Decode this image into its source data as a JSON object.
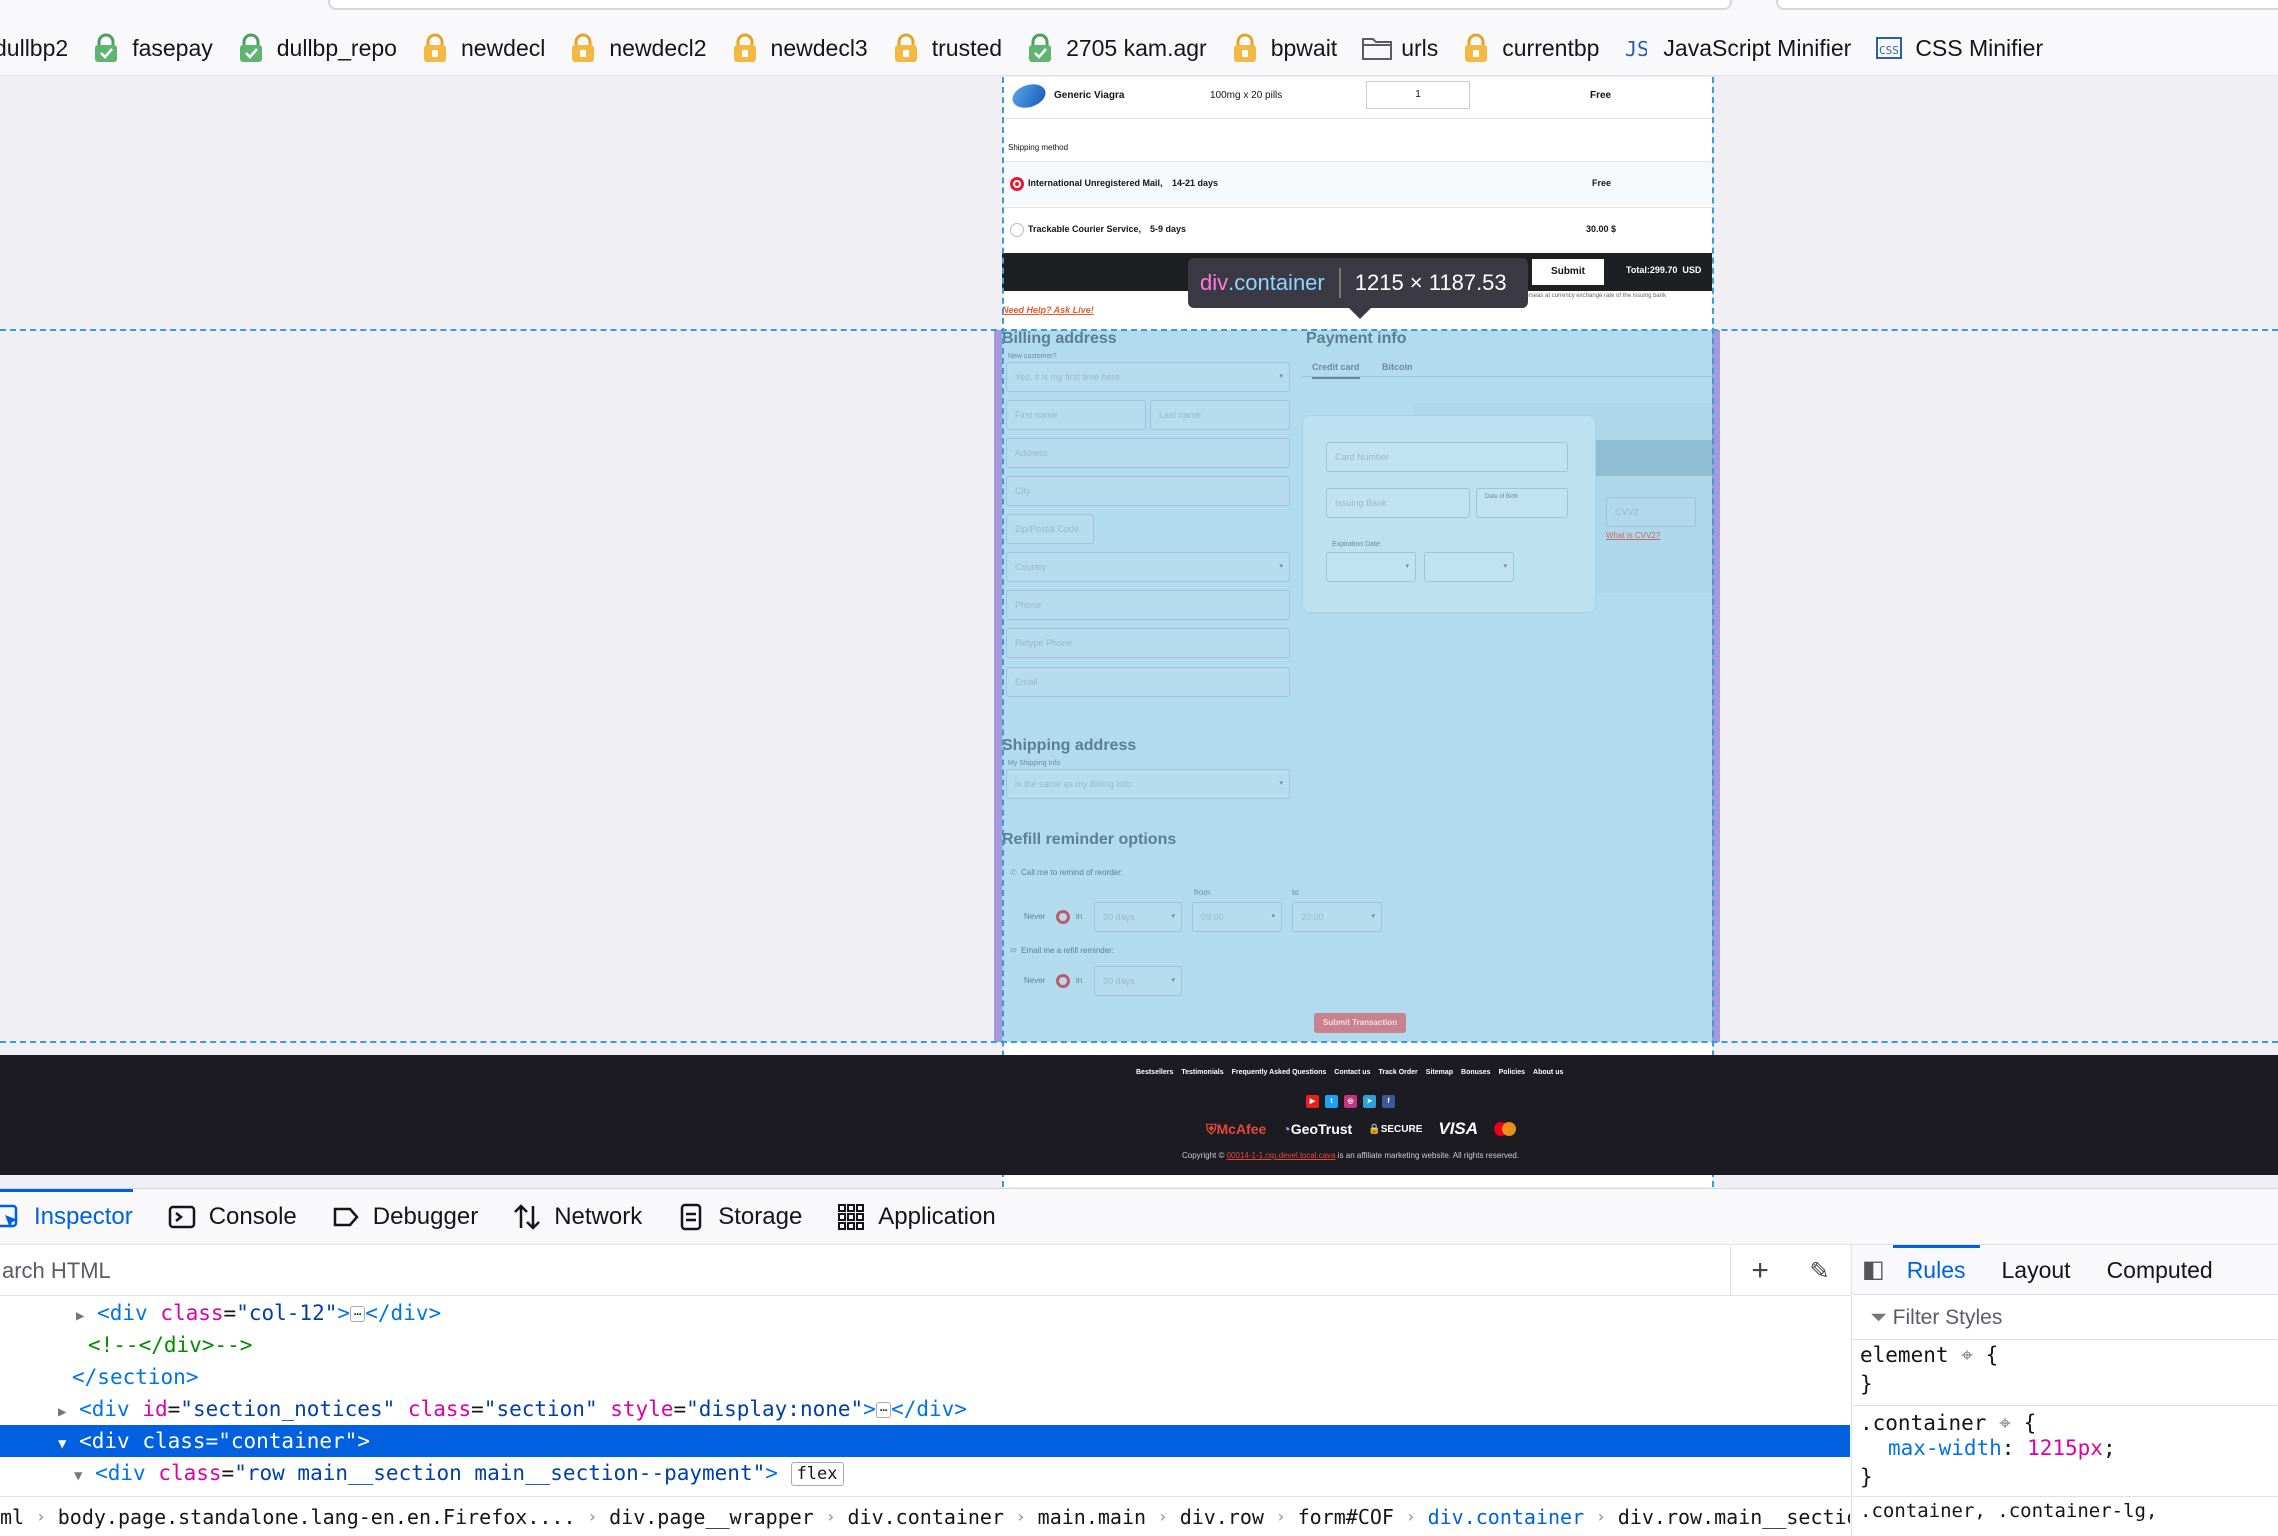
{
  "bookmarks": [
    {
      "label": "dullbp2",
      "icon": "none"
    },
    {
      "label": "fasepay",
      "icon": "green-lock-icon"
    },
    {
      "label": "dullbp_repo",
      "icon": "green-lock-icon"
    },
    {
      "label": "newdecl",
      "icon": "yellow-lock-icon"
    },
    {
      "label": "newdecl2",
      "icon": "yellow-lock-icon"
    },
    {
      "label": "newdecl3",
      "icon": "yellow-lock-icon"
    },
    {
      "label": "trusted",
      "icon": "yellow-lock-icon"
    },
    {
      "label": "2705 kam.agr",
      "icon": "green-lock-icon"
    },
    {
      "label": "bpwait",
      "icon": "yellow-lock-icon"
    },
    {
      "label": "urls",
      "icon": "folder-icon"
    },
    {
      "label": "currentbp",
      "icon": "yellow-lock-icon"
    },
    {
      "label": "JavaScript Minifier",
      "icon": "js-icon"
    },
    {
      "label": "CSS Minifier",
      "icon": "css-icon"
    }
  ],
  "order": {
    "product_name": "Generic Viagra",
    "dosage": "100mg x 20 pills",
    "quantity": "1",
    "price": "Free",
    "shipping_label": "Shipping method",
    "shipping_options": [
      {
        "name": "International Unregistered Mail,",
        "time": "14-21 days",
        "price": "Free",
        "selected": true
      },
      {
        "name": "Trackable Courier Service,",
        "time": "5-9 days",
        "price": "30.00 $",
        "selected": false
      }
    ],
    "submit_label": "Submit",
    "total_label": "Total:299.70",
    "total_currency": "USD",
    "exchange_note": "d overseas at currency exchange rate of the issuing bank",
    "help_link": "Need Help? Ask Live!"
  },
  "billing": {
    "title": "Billing address",
    "new_customer_label": "New customer?",
    "new_customer_value": "Yes, it is my first time here",
    "first_name": "First name",
    "last_name": "Last name",
    "address": "Address",
    "city": "City",
    "zip": "Zip/Postal Code",
    "country": "Country",
    "phone": "Phone",
    "retype_phone": "Retype Phone",
    "email": "Email"
  },
  "payment": {
    "title": "Payment info",
    "tabs": [
      "Credit card",
      "Bitcoin"
    ],
    "card_number": "Card Number",
    "issuing_bank": "Issuing Bank",
    "dob": "Date of Birth",
    "expiration": "Expiration Date:",
    "cvv": "CVV2",
    "what_cvv": "What is CVV2?"
  },
  "shipping_address": {
    "title": "Shipping address",
    "label": "My Shipping Info",
    "value": "is the same as my Billing Info"
  },
  "refill": {
    "title": "Refill reminder options",
    "call_label": "Call me to remind of reorder:",
    "never": "Never",
    "in": "in",
    "days": "30 days",
    "from_label": "from",
    "to_label": "to",
    "from_time": "09:00",
    "to_time": "20:00",
    "email_label": "Email me a refill reminder:",
    "email_days": "30 days",
    "submit_transaction": "Submit Transaction"
  },
  "footer": {
    "links": [
      "Bestsellers",
      "Testimonials",
      "Frequently Asked Questions",
      "Contact us",
      "Track Order",
      "Sitemap",
      "Bonuses",
      "Policies",
      "About us"
    ],
    "trust_badges": [
      "McAfee",
      "GeoTrust",
      "SECURE",
      "VISA"
    ],
    "copyright_prefix": "Copyright ©",
    "copyright_site": "00014-1-1.rxp.devel.local.cava",
    "copyright_suffix": "is an affiliate marketing website. All rights reserved."
  },
  "tooltip": {
    "tag": "div",
    "class": ".container",
    "size": "1215 × 1187.53"
  },
  "devtools": {
    "tabs": [
      "Inspector",
      "Console",
      "Debugger",
      "Network",
      "Storage",
      "Application"
    ],
    "search_placeholder": "arch HTML",
    "tree": [
      {
        "indent": 88,
        "arrow": "▶",
        "html": "col-12"
      },
      {
        "indent": 88,
        "comment": "<!--</div>-->"
      },
      {
        "indent": 72,
        "close": "section"
      },
      {
        "indent": 72,
        "arrow": "▶",
        "id": "section_notices",
        "class": "section",
        "style": "display:none"
      },
      {
        "indent": 72,
        "arrow": "▼",
        "selclass": "container"
      },
      {
        "indent": 88,
        "arrow": "▼",
        "rowclass": "row main__section main__section--payment",
        "badge": "flex"
      }
    ],
    "breadcrumbs": [
      "ml",
      "body.page.standalone.lang-en.en.Firefox....",
      "div.page__wrapper",
      "div.container",
      "main.main",
      "div.row",
      "form#COF",
      "div.container",
      "div.row.main__section.ma"
    ],
    "rules_tabs": [
      "Rules",
      "Layout",
      "Computed"
    ],
    "filter_placeholder": "Filter Styles",
    "element_selector": "element",
    "container_selector": ".container",
    "max_width_prop": "max-width",
    "max_width_value": "1215px",
    "next_selector": ".container, .container-lg,"
  }
}
